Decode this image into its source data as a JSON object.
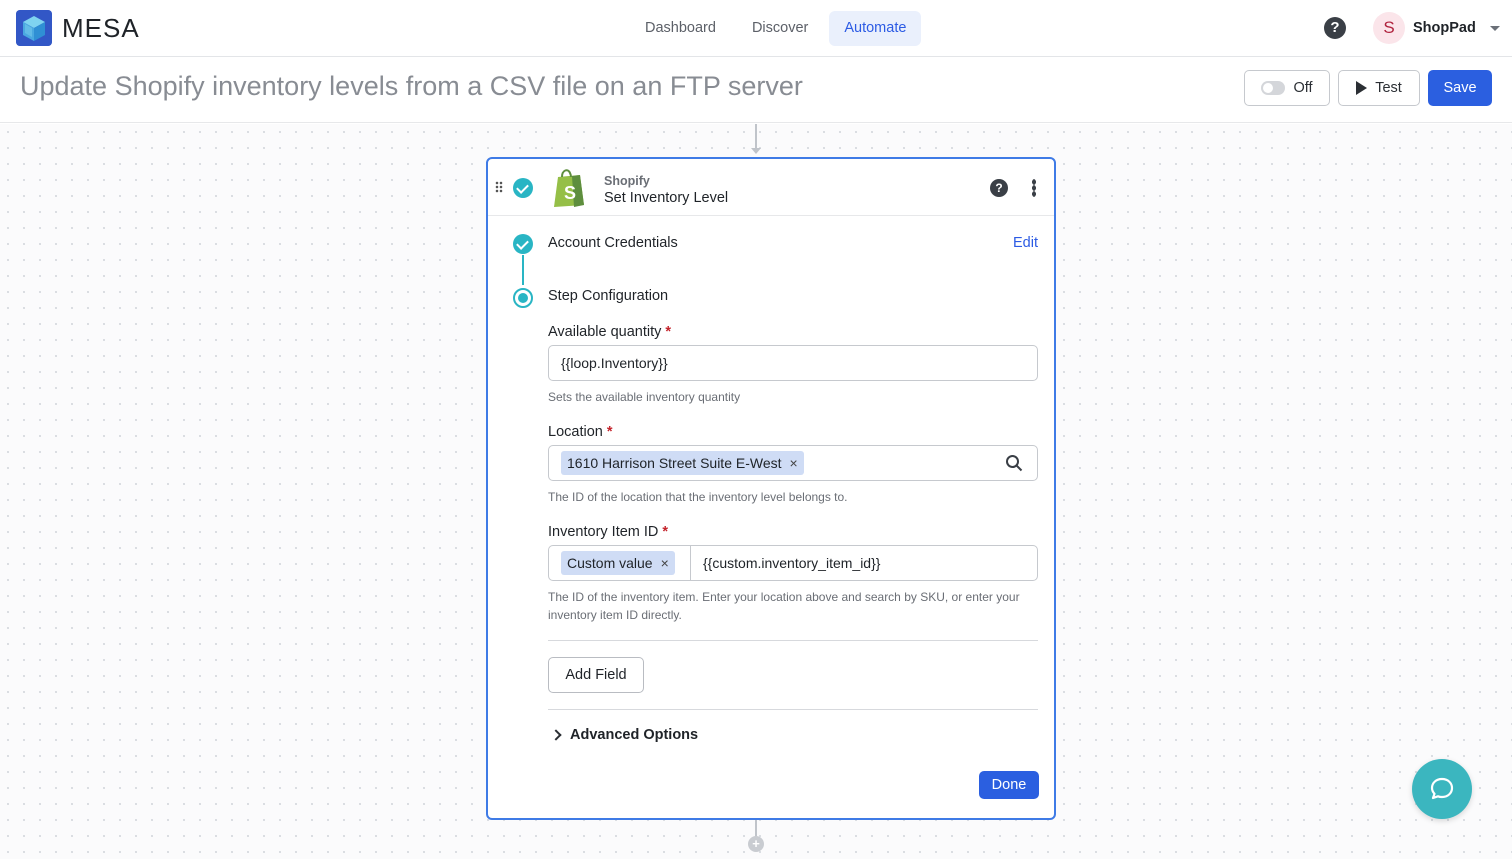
{
  "app": {
    "brand": "MESA",
    "brand_color": "#2b5fe0"
  },
  "nav": {
    "tabs": [
      {
        "label": "Dashboard",
        "active": false
      },
      {
        "label": "Discover",
        "active": false
      },
      {
        "label": "Automate",
        "active": true
      }
    ],
    "help_icon": "question-circle-icon",
    "user": {
      "initial": "S",
      "name": "ShopPad"
    }
  },
  "workflow": {
    "title": "Update Shopify inventory levels from a CSV file on an FTP server",
    "toggle_label": "Off",
    "toggle_state": "off",
    "test_label": "Test",
    "save_label": "Save"
  },
  "step": {
    "app_name": "Shopify",
    "step_name": "Set Inventory Level",
    "sections": {
      "credentials_label": "Account Credentials",
      "credentials_edit": "Edit",
      "config_label": "Step Configuration"
    },
    "fields": {
      "quantity": {
        "label": "Available quantity",
        "required_mark": "*",
        "value": "{{loop.Inventory}}",
        "hint": "Sets the available inventory quantity"
      },
      "location": {
        "label": "Location",
        "required_mark": "*",
        "tag": "1610 Harrison Street Suite E-West",
        "tag_remove": "×",
        "hint": "The ID of the location that the inventory level belongs to."
      },
      "item_id": {
        "label": "Inventory Item ID",
        "required_mark": "*",
        "tag": "Custom value",
        "tag_remove": "×",
        "value": "{{custom.inventory_item_id}}",
        "hint": "The ID of the inventory item. Enter your location above and search by SKU, or enter your inventory item ID directly."
      }
    },
    "add_field_label": "Add Field",
    "advanced_label": "Advanced Options",
    "done_label": "Done",
    "plus_label": "+"
  }
}
